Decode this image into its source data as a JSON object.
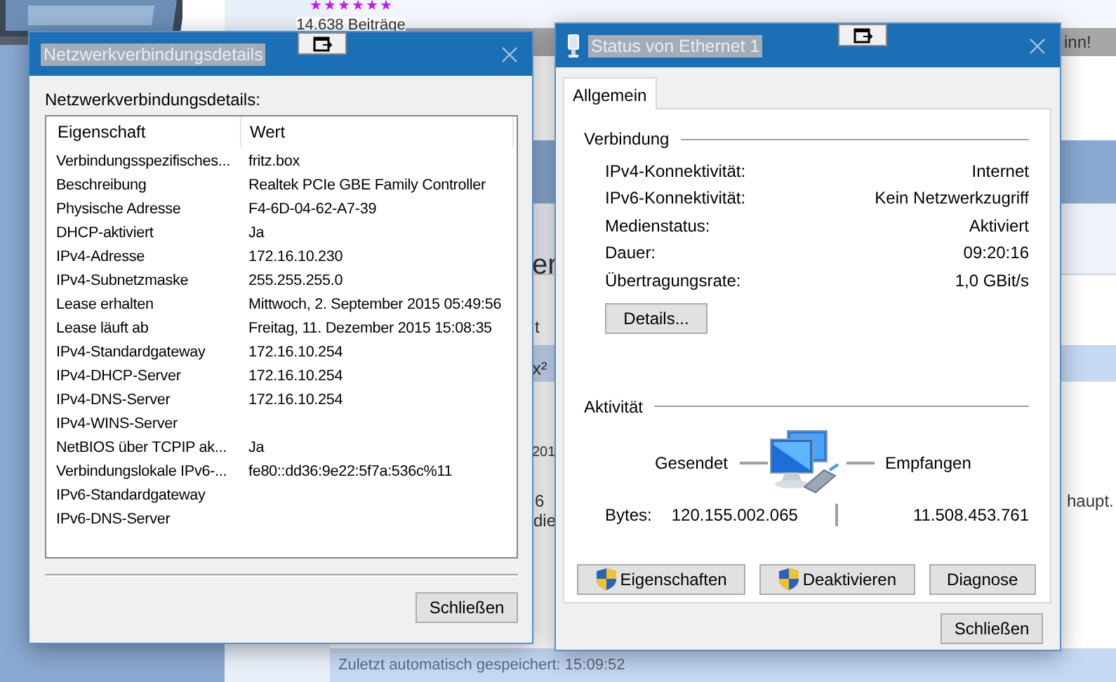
{
  "background": {
    "stars": 6,
    "post_count": "14.638 Beiträge",
    "fragments": [
      {
        "text": "inn!"
      },
      {
        "text": "er"
      },
      {
        "text": "t"
      },
      {
        "text": "x²"
      },
      {
        "text": "201"
      },
      {
        "text": "6"
      },
      {
        "text": "haupt."
      },
      {
        "text": "die"
      }
    ],
    "status": "Zuletzt automatisch gespeichert: 15:09:52"
  },
  "details_window": {
    "title": "Netzwerkverbindungsdetails",
    "title_highlighted": true,
    "label": "Netzwerkverbindungsdetails:",
    "columns": [
      "Eigenschaft",
      "Wert"
    ],
    "rows": [
      {
        "property": "Verbindungsspezifisches...",
        "value": "fritz.box"
      },
      {
        "property": "Beschreibung",
        "value": "Realtek PCIe GBE Family Controller"
      },
      {
        "property": "Physische Adresse",
        "value": "F4-6D-04-62-A7-39"
      },
      {
        "property": "DHCP-aktiviert",
        "value": "Ja"
      },
      {
        "property": "IPv4-Adresse",
        "value": "172.16.10.230"
      },
      {
        "property": "IPv4-Subnetzmaske",
        "value": "255.255.255.0"
      },
      {
        "property": "Lease erhalten",
        "value": "Mittwoch, 2. September 2015 05:49:56"
      },
      {
        "property": "Lease läuft ab",
        "value": "Freitag, 11. Dezember 2015 15:08:35"
      },
      {
        "property": "IPv4-Standardgateway",
        "value": "172.16.10.254"
      },
      {
        "property": "IPv4-DHCP-Server",
        "value": "172.16.10.254"
      },
      {
        "property": "IPv4-DNS-Server",
        "value": "172.16.10.254"
      },
      {
        "property": "IPv4-WINS-Server"
      },
      {
        "property": "NetBIOS über TCPIP ak...",
        "value": "Ja"
      },
      {
        "property": "Verbindungslokale IPv6-...",
        "value": "fe80::dd36:9e22:5f7a:536c%11"
      },
      {
        "property": "IPv6-Standardgateway"
      },
      {
        "property": "IPv6-DNS-Server"
      }
    ],
    "close_button": "Schließen"
  },
  "status_window": {
    "title": "Status von Ethernet 1",
    "title_highlighted": true,
    "tabs": [
      {
        "label": "Allgemein",
        "selected": true
      }
    ],
    "connection": {
      "heading": "Verbindung",
      "rows": [
        {
          "label": "IPv4-Konnektivität:",
          "value": "Internet"
        },
        {
          "label": "IPv6-Konnektivität:",
          "value": "Kein Netzwerkzugriff"
        },
        {
          "label": "Medienstatus:",
          "value": "Aktiviert"
        },
        {
          "label": "Dauer:",
          "value": "09:20:16"
        },
        {
          "label": "Übertragungsrate:",
          "value": "1,0 GBit/s"
        }
      ],
      "details_button": "Details..."
    },
    "activity": {
      "heading": "Aktivität",
      "sent_label": "Gesendet",
      "received_label": "Empfangen",
      "bytes_label": "Bytes:",
      "sent": "120.155.002.065",
      "received": "11.508.453.761"
    },
    "buttons": [
      {
        "label": "Eigenschaften",
        "shield": true
      },
      {
        "label": "Deaktivieren",
        "shield": true
      },
      {
        "label": "Diagnose",
        "shield": false
      }
    ],
    "close_button": "Schließen"
  }
}
